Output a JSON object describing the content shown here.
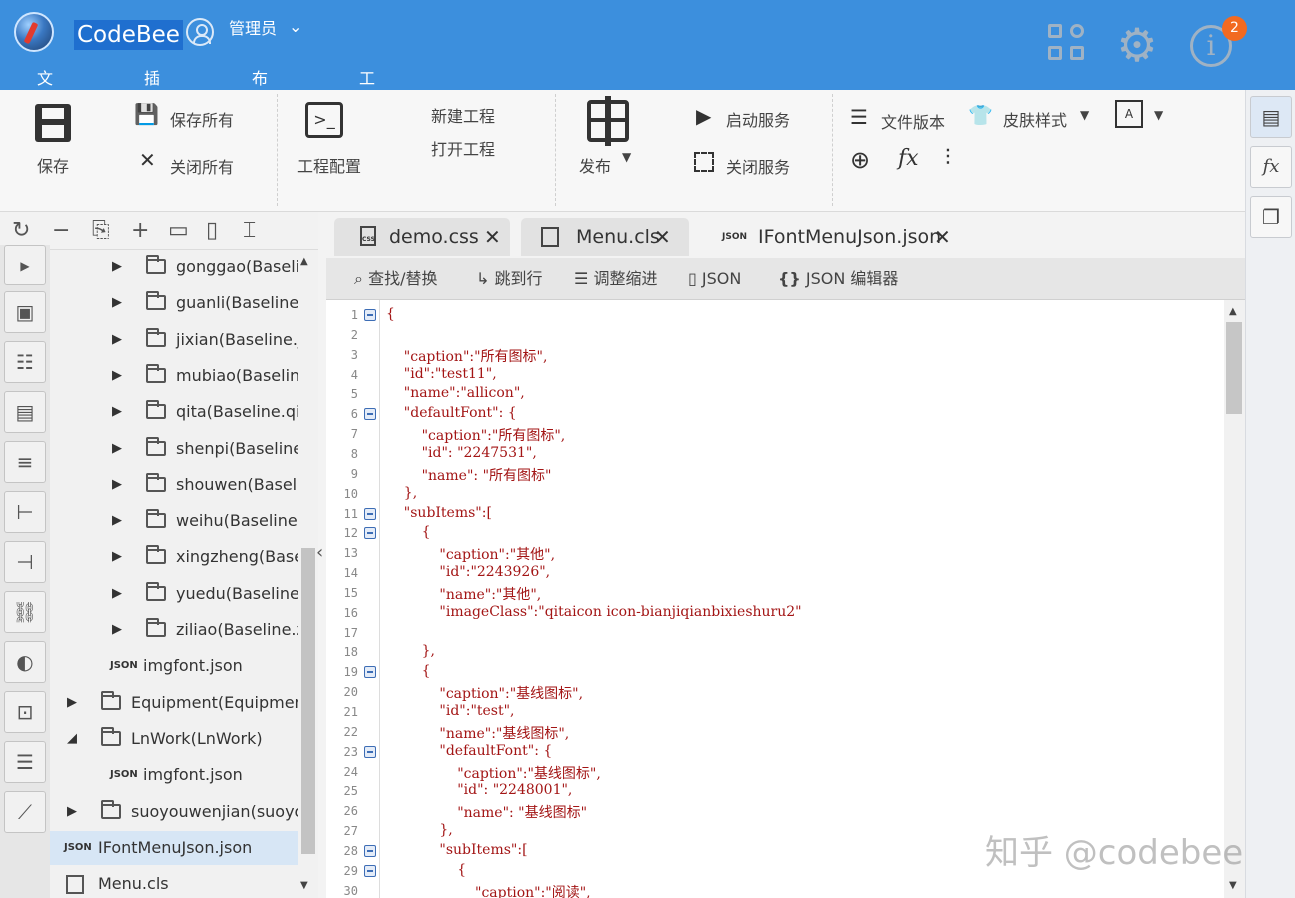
{
  "app": {
    "name": "CodeBee",
    "user": "管理员"
  },
  "menu": [
    "文档",
    "插入",
    "布局",
    "工具"
  ],
  "notification_count": "2",
  "ribbon": {
    "save": "保存",
    "save_all": "保存所有",
    "close_all": "关闭所有",
    "project_config": "工程配置",
    "new_project": "新建工程",
    "open_project": "打开工程",
    "publish": "发布",
    "start_service": "启动服务",
    "stop_service": "关闭服务",
    "file_version": "文件版本",
    "skin_style": "皮肤样式"
  },
  "tree": {
    "items": [
      {
        "label": "gonggao(Baselir",
        "type": "folder",
        "level": 2
      },
      {
        "label": "guanli(Baseline.",
        "type": "folder",
        "level": 2
      },
      {
        "label": "jixian(Baseline.ji",
        "type": "folder",
        "level": 2
      },
      {
        "label": "mubiao(Baseline",
        "type": "folder",
        "level": 2
      },
      {
        "label": "qita(Baseline.qit",
        "type": "folder",
        "level": 2
      },
      {
        "label": "shenpi(Baseline.",
        "type": "folder",
        "level": 2
      },
      {
        "label": "shouwen(Baselir",
        "type": "folder",
        "level": 2
      },
      {
        "label": "weihu(Baseline.",
        "type": "folder",
        "level": 2
      },
      {
        "label": "xingzheng(Basel",
        "type": "folder",
        "level": 2
      },
      {
        "label": "yuedu(Baseline.",
        "type": "folder",
        "level": 2
      },
      {
        "label": "ziliao(Baseline.zi",
        "type": "folder",
        "level": 2
      },
      {
        "label": "imgfont.json",
        "type": "json",
        "level": 2
      },
      {
        "label": "Equipment(Equipment",
        "type": "folder",
        "level": 1
      },
      {
        "label": "LnWork(LnWork)",
        "type": "folder-open",
        "level": 1
      },
      {
        "label": "imgfont.json",
        "type": "json",
        "level": 2
      },
      {
        "label": "suoyouwenjian(suoyou",
        "type": "folder",
        "level": 1
      },
      {
        "label": "IFontMenuJson.json",
        "type": "json",
        "level": 0,
        "selected": true
      },
      {
        "label": "Menu.cls",
        "type": "cls",
        "level": 0
      }
    ]
  },
  "tabs": [
    {
      "label": "demo.css",
      "icon": "css-file-icon"
    },
    {
      "label": "Menu.cls",
      "icon": "cls-file-icon"
    },
    {
      "label": "IFontMenuJson.json",
      "icon": "json-file-icon",
      "active": true
    }
  ],
  "editor_toolbar": {
    "find_replace": "查找/替换",
    "goto_line": "跳到行",
    "indent": "调整缩进",
    "json": "JSON",
    "json_editor": "JSON 编辑器"
  },
  "code_lines": [
    "{",
    "",
    "    \"caption\":\"所有图标\",",
    "    \"id\":\"test11\",",
    "    \"name\":\"allicon\",",
    "    \"defaultFont\": {",
    "        \"caption\":\"所有图标\",",
    "        \"id\": \"2247531\",",
    "        \"name\": \"所有图标\"",
    "    },",
    "    \"subItems\":[",
    "        {",
    "            \"caption\":\"其他\",",
    "            \"id\":\"2243926\",",
    "            \"name\":\"其他\",",
    "            \"imageClass\":\"qitaicon icon-bianjiqianbixieshuru2\"",
    "",
    "        },",
    "        {",
    "            \"caption\":\"基线图标\",",
    "            \"id\":\"test\",",
    "            \"name\":\"基线图标\",",
    "            \"defaultFont\": {",
    "                \"caption\":\"基线图标\",",
    "                \"id\": \"2248001\",",
    "                \"name\": \"基线图标\"",
    "            },",
    "            \"subItems\":[",
    "                {",
    "                    \"caption\":\"阅读\","
  ],
  "fold_lines": [
    1,
    6,
    11,
    12,
    19,
    23,
    28,
    29
  ],
  "watermark": "知乎 @codebee"
}
